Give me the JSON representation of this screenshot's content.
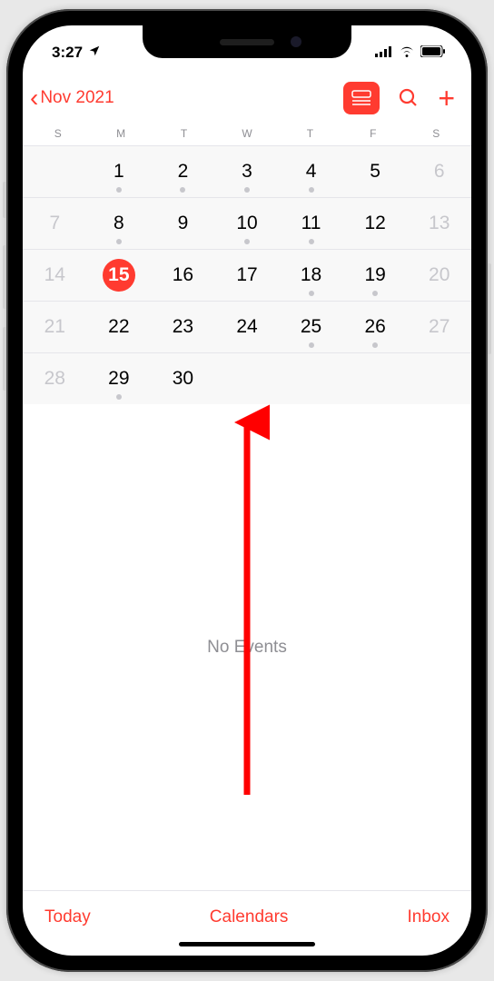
{
  "status": {
    "time": "3:27",
    "location_icon": "location-arrow"
  },
  "nav": {
    "back_label": "Nov 2021",
    "view_mode_icon": "list-day-view",
    "search_icon": "search",
    "add_icon": "add"
  },
  "weekdays": [
    "S",
    "M",
    "T",
    "W",
    "T",
    "F",
    "S"
  ],
  "calendar": {
    "selected_day": 15,
    "weeks": [
      [
        {
          "num": "",
          "dimmed": true,
          "dot": false
        },
        {
          "num": "1",
          "dimmed": false,
          "dot": true
        },
        {
          "num": "2",
          "dimmed": false,
          "dot": true
        },
        {
          "num": "3",
          "dimmed": false,
          "dot": true
        },
        {
          "num": "4",
          "dimmed": false,
          "dot": true
        },
        {
          "num": "5",
          "dimmed": false,
          "dot": false
        },
        {
          "num": "6",
          "dimmed": true,
          "dot": false
        }
      ],
      [
        {
          "num": "7",
          "dimmed": true,
          "dot": false
        },
        {
          "num": "8",
          "dimmed": false,
          "dot": true
        },
        {
          "num": "9",
          "dimmed": false,
          "dot": false
        },
        {
          "num": "10",
          "dimmed": false,
          "dot": true
        },
        {
          "num": "11",
          "dimmed": false,
          "dot": true
        },
        {
          "num": "12",
          "dimmed": false,
          "dot": false
        },
        {
          "num": "13",
          "dimmed": true,
          "dot": false
        }
      ],
      [
        {
          "num": "14",
          "dimmed": true,
          "dot": false
        },
        {
          "num": "15",
          "dimmed": false,
          "dot": false,
          "selected": true
        },
        {
          "num": "16",
          "dimmed": false,
          "dot": false
        },
        {
          "num": "17",
          "dimmed": false,
          "dot": false
        },
        {
          "num": "18",
          "dimmed": false,
          "dot": true
        },
        {
          "num": "19",
          "dimmed": false,
          "dot": true
        },
        {
          "num": "20",
          "dimmed": true,
          "dot": false
        }
      ],
      [
        {
          "num": "21",
          "dimmed": true,
          "dot": false
        },
        {
          "num": "22",
          "dimmed": false,
          "dot": false
        },
        {
          "num": "23",
          "dimmed": false,
          "dot": false
        },
        {
          "num": "24",
          "dimmed": false,
          "dot": false
        },
        {
          "num": "25",
          "dimmed": false,
          "dot": true
        },
        {
          "num": "26",
          "dimmed": false,
          "dot": true
        },
        {
          "num": "27",
          "dimmed": true,
          "dot": false
        }
      ],
      [
        {
          "num": "28",
          "dimmed": true,
          "dot": false
        },
        {
          "num": "29",
          "dimmed": false,
          "dot": true
        },
        {
          "num": "30",
          "dimmed": false,
          "dot": false
        },
        {
          "num": "",
          "dimmed": true,
          "dot": false
        },
        {
          "num": "",
          "dimmed": true,
          "dot": false
        },
        {
          "num": "",
          "dimmed": true,
          "dot": false
        },
        {
          "num": "",
          "dimmed": true,
          "dot": false
        }
      ]
    ]
  },
  "events": {
    "empty_label": "No Events"
  },
  "toolbar": {
    "today_label": "Today",
    "calendars_label": "Calendars",
    "inbox_label": "Inbox"
  },
  "colors": {
    "accent": "#ff3b30",
    "muted": "#8e8e93"
  },
  "annotation": {
    "type": "swipe-up-arrow",
    "color": "#ff0000"
  }
}
